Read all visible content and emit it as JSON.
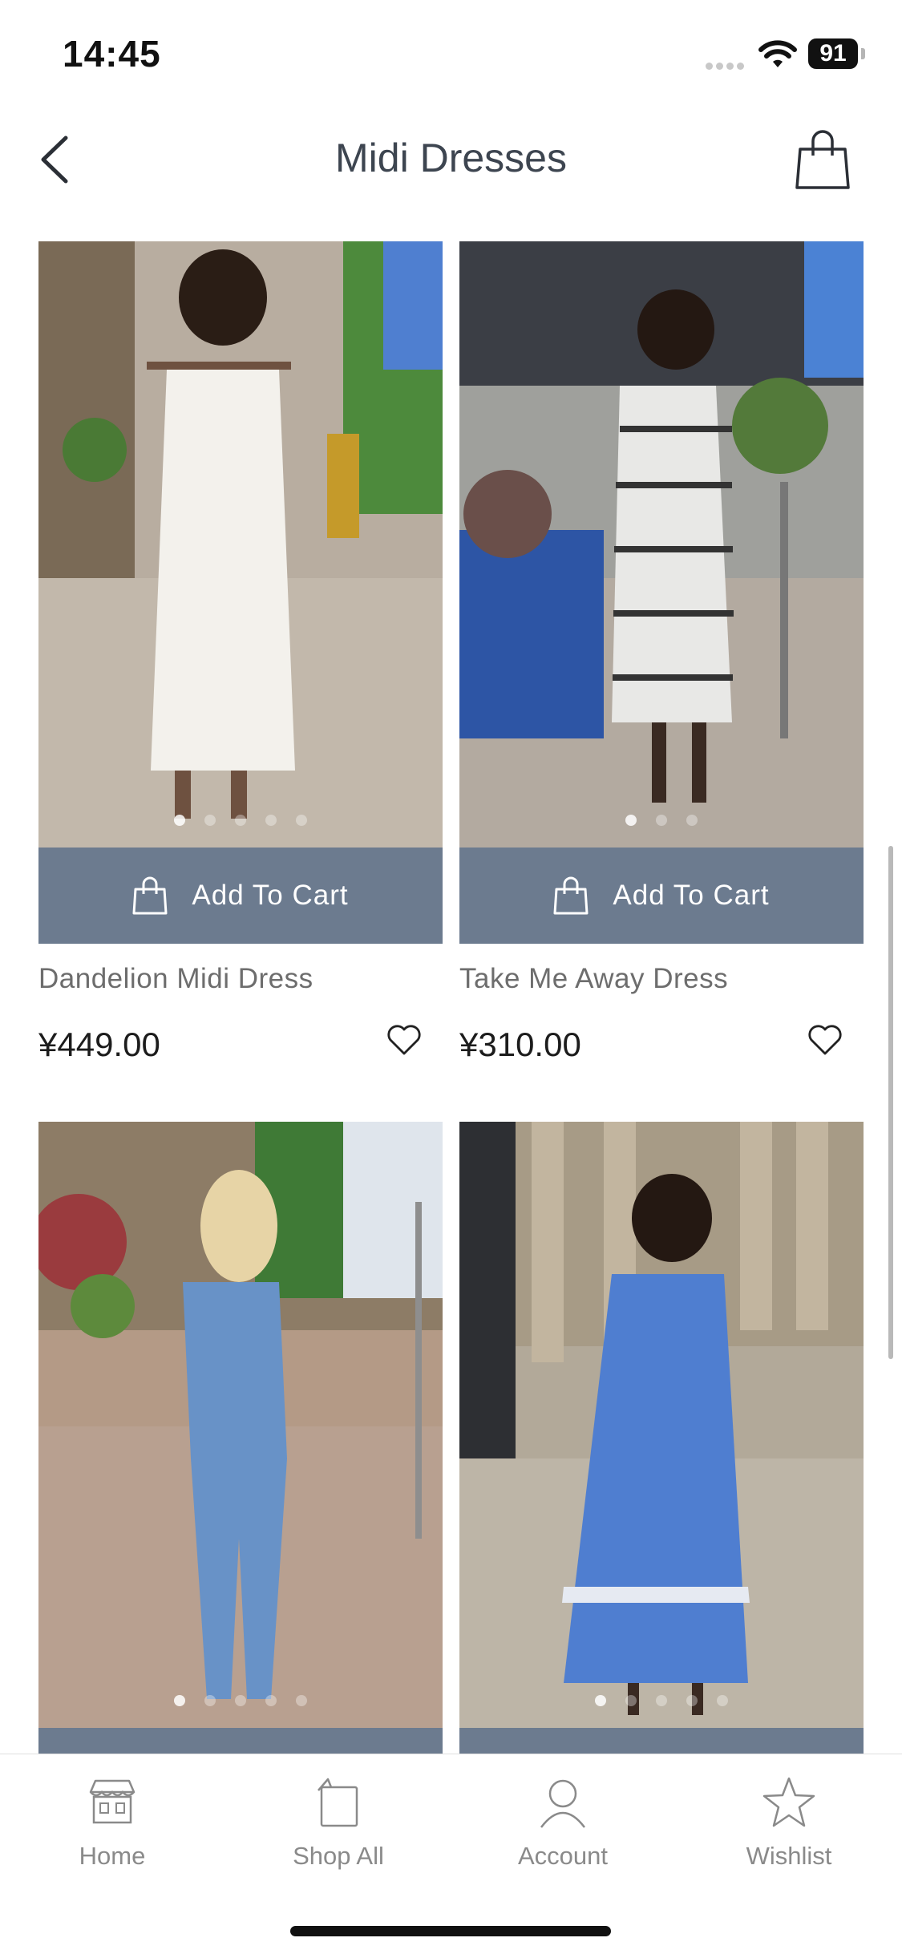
{
  "status_bar": {
    "time": "14:45",
    "battery": "91"
  },
  "header": {
    "title": "Midi Dresses"
  },
  "products": [
    {
      "name": "Dandelion Midi Dress",
      "price": "¥449.00",
      "cart_label": "Add To Cart"
    },
    {
      "name": "Take Me Away Dress",
      "price": "¥310.00",
      "cart_label": "Add To Cart"
    },
    {
      "name": "",
      "price": "",
      "cart_label": ""
    },
    {
      "name": "",
      "price": "",
      "cart_label": ""
    }
  ],
  "tabs": [
    {
      "label": "Home",
      "icon": "store-icon"
    },
    {
      "label": "Shop All",
      "icon": "shopping-bag-icon"
    },
    {
      "label": "Account",
      "icon": "user-icon"
    },
    {
      "label": "Wishlist",
      "icon": "star-icon"
    }
  ],
  "colors": {
    "accent": "#6c7b8f",
    "title": "#3d4550",
    "tab_label": "#8a8a8a"
  }
}
